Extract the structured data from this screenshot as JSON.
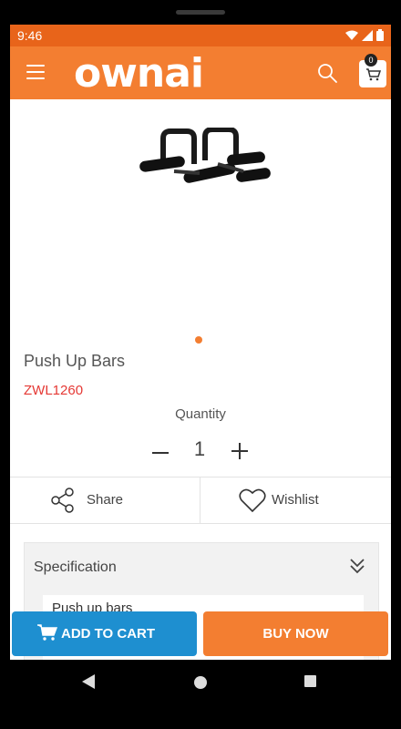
{
  "status_bar": {
    "time": "9:46"
  },
  "header": {
    "logo_text": "ownai",
    "cart_count": "0"
  },
  "product": {
    "name": "Push Up Bars",
    "code": "ZWL1260",
    "quantity_label": "Quantity",
    "quantity": "1",
    "decrement_symbol": "–",
    "increment_symbol": "+"
  },
  "actions": {
    "share_label": "Share",
    "wishlist_label": "Wishlist"
  },
  "specification": {
    "title": "Specification",
    "content": "Push up bars"
  },
  "footer": {
    "add_to_cart_label": "ADD TO CART",
    "buy_now_label": "BUY NOW"
  },
  "colors": {
    "accent": "#f37e31",
    "status_bar": "#e8641a",
    "cart_button": "#1e8fd0",
    "product_code": "#e53935"
  },
  "icons": [
    "menu-icon",
    "search-icon",
    "cart-icon",
    "share-icon",
    "heart-icon",
    "chevron-double-down-icon",
    "back-icon",
    "home-icon",
    "recent-apps-icon"
  ]
}
